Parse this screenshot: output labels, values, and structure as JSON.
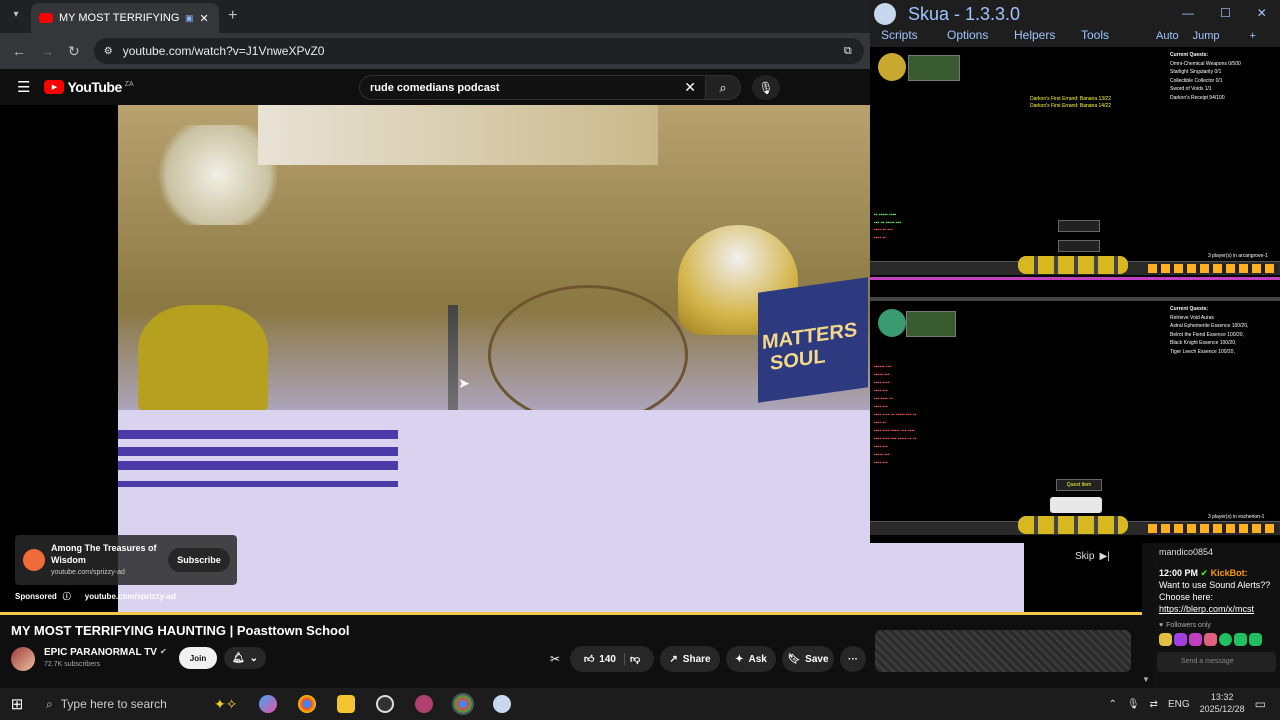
{
  "browser": {
    "tab_title": "MY MOST TERRIFYING HAU",
    "url": "youtube.com/watch?v=J1VnweXPvZ0"
  },
  "youtube": {
    "logo": "YouTube",
    "logo_region": "ZA",
    "search_value": "rude comedians podcast"
  },
  "ad": {
    "title": "Among The Treasures of Wisdom",
    "domain": "youtube.com/sprizzy-ad",
    "subscribe_label": "Subscribe",
    "sponsored_label": "Sponsored",
    "sponsored_domain": "youtube.com/sprizzy-ad",
    "skip_label": "Skip"
  },
  "video": {
    "title": "MY MOST TERRIFYING HAUNTING | Poasttown School",
    "frame_text": [
      "MATTERS",
      "SOUL"
    ],
    "channel": "EPIC PARANORMAL TV",
    "subscribers": "72.7K subscribers",
    "join_label": "Join",
    "likes": "140",
    "share_label": "Share",
    "ask_label": "Ask",
    "save_label": "Save",
    "more_label": "···"
  },
  "skua": {
    "title": "Skua - 1.3.3.0",
    "menu": [
      "Scripts",
      "Options",
      "Helpers",
      "Tools"
    ],
    "menu_right": [
      "Auto",
      "Jump",
      "+"
    ],
    "game1": {
      "quests_header": "Current Quests:",
      "quests": [
        "Omni-Chemical Weapons 0/500",
        "Starlight Singularity 0/1",
        "Collectible Collector 0/1",
        "Sword of Voids 1/1",
        "Darkon's Receipt 94/100"
      ],
      "center_lines": [
        "Darkon's First Errand: Banana 13/22",
        "Darkon's First Errand: Banana 14/22"
      ],
      "players": "3 player(s) in arcangrove-1"
    },
    "game2": {
      "quests_header": "Current Quests:",
      "quests": [
        "Retrieve Void Auras",
        "Astral Ephemerite Essence 100/20,",
        "Belrot the Fiend Essence 100/20,",
        "Black Knight Essence 100/20,",
        "Tiger Leech Essence 100/20,"
      ],
      "players": "3 player(s) in escherion-1",
      "toast": "Quest Item"
    }
  },
  "chat": {
    "user": "mandico0854",
    "time": "12:00 PM",
    "bot": "KickBot:",
    "message": "Want to use Sound Alerts?? Choose here:",
    "link": "https://blerp.com/x/mcst",
    "followers_only": "Followers only",
    "send_placeholder": "Send a message"
  },
  "taskbar": {
    "search_placeholder": "Type here to search",
    "lang": "ENG",
    "time": "13:32",
    "date": "2025/12/28"
  },
  "colors": {
    "youtube_red": "#ff0000",
    "progress_yellow": "#f2c94c",
    "skua_blue": "#9ec5ff",
    "quest_yellow": "#ffff33"
  }
}
